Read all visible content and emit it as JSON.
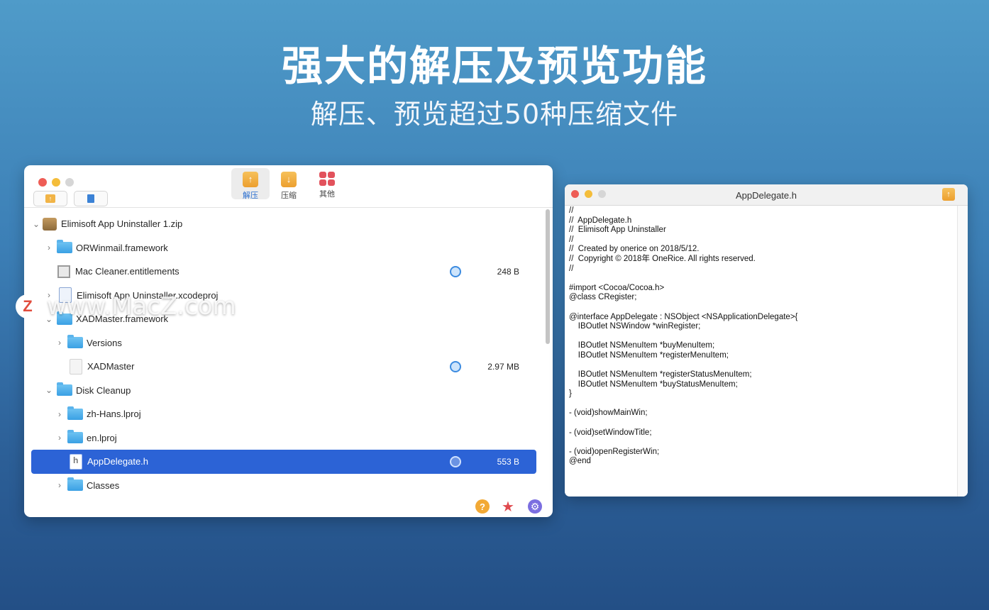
{
  "hero": {
    "title": "强大的解压及预览功能",
    "subtitle": "解压、预览超过50种压缩文件"
  },
  "main_window": {
    "toolbar": {
      "extract_label": "解压",
      "compress_label": "压缩",
      "other_label": "其他"
    },
    "tree": [
      {
        "name": "Elimisoft App Uninstaller 1.zip",
        "chevron": "⌄",
        "size": ""
      },
      {
        "name": "ORWinmail.framework",
        "chevron": "›",
        "size": ""
      },
      {
        "name": "Mac Cleaner.entitlements",
        "chevron": "",
        "size": "248 B"
      },
      {
        "name": "Elimisoft App Uninstaller.xcodeproj",
        "chevron": "›",
        "size": ""
      },
      {
        "name": "XADMaster.framework",
        "chevron": "⌄",
        "size": ""
      },
      {
        "name": "Versions",
        "chevron": "›",
        "size": ""
      },
      {
        "name": "XADMaster",
        "chevron": "",
        "size": "2.97 MB"
      },
      {
        "name": "Disk Cleanup",
        "chevron": "⌄",
        "size": ""
      },
      {
        "name": "zh-Hans.lproj",
        "chevron": "›",
        "size": ""
      },
      {
        "name": "en.lproj",
        "chevron": "›",
        "size": ""
      },
      {
        "name": "AppDelegate.h",
        "chevron": "",
        "size": "553 B"
      },
      {
        "name": "Classes",
        "chevron": "›",
        "size": ""
      }
    ],
    "footer": {
      "help": "?",
      "star": "★",
      "settings": "⚙"
    }
  },
  "preview_window": {
    "title": "AppDelegate.h",
    "code": "//\n//  AppDelegate.h\n//  Elimisoft App Uninstaller\n//\n//  Created by onerice on 2018/5/12.\n//  Copyright © 2018年 OneRice. All rights reserved.\n//\n\n#import <Cocoa/Cocoa.h>\n@class CRegister;\n\n@interface AppDelegate : NSObject <NSApplicationDelegate>{\n    IBOutlet NSWindow *winRegister;\n\n    IBOutlet NSMenuItem *buyMenuItem;\n    IBOutlet NSMenuItem *registerMenuItem;\n\n    IBOutlet NSMenuItem *registerStatusMenuItem;\n    IBOutlet NSMenuItem *buyStatusMenuItem;\n}\n\n- (void)showMainWin;\n\n- (void)setWindowTitle;\n\n- (void)openRegisterWin;\n@end"
  },
  "watermark": {
    "badge": "Z",
    "text": "www.MacZ.com"
  },
  "colors": {
    "selection": "#2c63d6",
    "accent_orange": "#ec9f2f",
    "close": "#ee5d56",
    "minimize": "#f4bd3a"
  }
}
